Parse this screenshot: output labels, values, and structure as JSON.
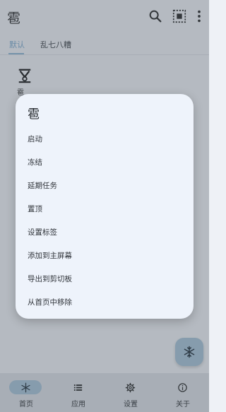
{
  "appbar": {
    "title": "雹",
    "search_icon": "search-icon",
    "select_all_icon": "select-all-icon"
  },
  "tabs": [
    {
      "label": "默认",
      "active": true
    },
    {
      "label": "乱七八糟",
      "active": false
    }
  ],
  "content": {
    "app_entry_label": "雹",
    "app_entry_icon": "hail-app-icon"
  },
  "dialog": {
    "title": "雹",
    "items": [
      {
        "label": "启动"
      },
      {
        "label": "冻结"
      },
      {
        "label": "延期任务"
      },
      {
        "label": "置顶"
      },
      {
        "label": "设置标签"
      },
      {
        "label": "添加到主屏幕"
      },
      {
        "label": "导出到剪切板"
      },
      {
        "label": "从首页中移除"
      }
    ]
  },
  "fab": {
    "icon": "snowflake-icon"
  },
  "bottom_nav": [
    {
      "label": "首页",
      "icon": "snowflake-icon",
      "active": true
    },
    {
      "label": "应用",
      "icon": "list-icon",
      "active": false
    },
    {
      "label": "设置",
      "icon": "gear-icon",
      "active": false
    },
    {
      "label": "关于",
      "icon": "info-icon",
      "active": false
    }
  ],
  "colors": {
    "accent": "#a8c5da",
    "tab_active_text": "#7aa9cf",
    "dialog_bg": "#eef3fb",
    "nav_bg": "#dfe3e8"
  }
}
